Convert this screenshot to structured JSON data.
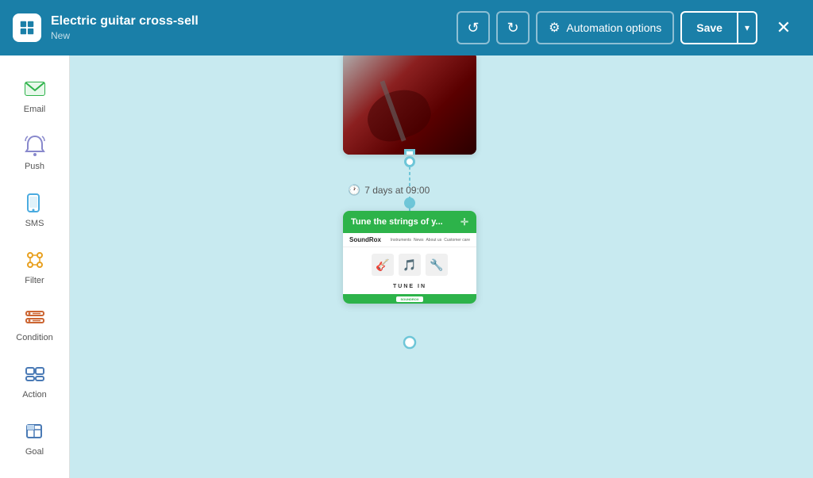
{
  "header": {
    "logo_alt": "Klaviyo logo",
    "title": "Electric guitar cross-sell",
    "subtitle": "New",
    "undo_label": "Undo",
    "redo_label": "Redo",
    "automation_options_label": "Automation options",
    "save_label": "Save",
    "save_dropdown_label": "▾",
    "close_label": "✕"
  },
  "sidebar": {
    "items": [
      {
        "id": "email",
        "label": "Email",
        "icon": "email-icon"
      },
      {
        "id": "push",
        "label": "Push",
        "icon": "push-icon"
      },
      {
        "id": "sms",
        "label": "SMS",
        "icon": "sms-icon"
      },
      {
        "id": "filter",
        "label": "Filter",
        "icon": "filter-icon"
      },
      {
        "id": "condition",
        "label": "Condition",
        "icon": "condition-icon"
      },
      {
        "id": "action",
        "label": "Action",
        "icon": "action-icon"
      },
      {
        "id": "goal",
        "label": "Goal",
        "icon": "goal-icon"
      }
    ]
  },
  "canvas": {
    "delay_label": "7 days at 09:00",
    "email_card": {
      "title": "Tune the strings of y...",
      "brand": "SoundRox",
      "nav_items": [
        "Instruments",
        "News",
        "About us",
        "Customer care"
      ],
      "tune_in_text": "TUNE IN",
      "footer_btn": "SOUNDROX"
    }
  },
  "colors": {
    "header_bg": "#1a7fa8",
    "canvas_bg": "#c8eaf0",
    "email_green": "#2db34a",
    "connector_blue": "#6ec6d8"
  }
}
